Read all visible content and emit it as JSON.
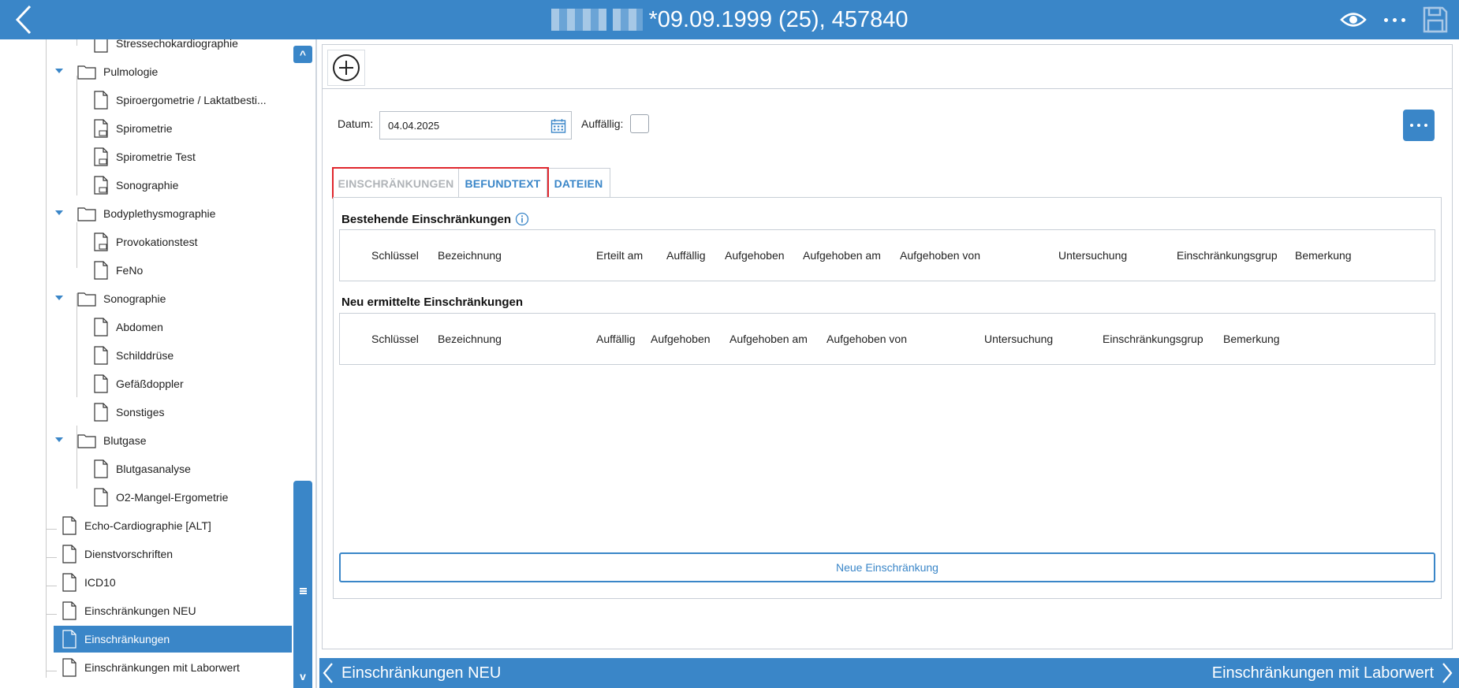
{
  "header": {
    "title": "*09.09.1999 (25), 457840",
    "back_icon": "chevron-left-icon",
    "view_icon": "eye-icon",
    "more_icon": "more-horizontal-icon",
    "save_icon": "floppy-disk-icon"
  },
  "tree": {
    "items": [
      {
        "label": "Stressechokardiographie",
        "kind": "doc"
      },
      {
        "label": "Pulmologie",
        "kind": "folder"
      },
      {
        "label": "Spiroergometrie / Laktatbesti...",
        "kind": "doc"
      },
      {
        "label": "Spirometrie",
        "kind": "form"
      },
      {
        "label": "Spirometrie Test",
        "kind": "form"
      },
      {
        "label": "Sonographie",
        "kind": "form"
      },
      {
        "label": "Bodyplethysmographie",
        "kind": "folder"
      },
      {
        "label": "Provokationstest",
        "kind": "form"
      },
      {
        "label": "FeNo",
        "kind": "doc"
      },
      {
        "label": "Sonographie",
        "kind": "folder"
      },
      {
        "label": "Abdomen",
        "kind": "doc"
      },
      {
        "label": "Schilddrüse",
        "kind": "doc"
      },
      {
        "label": "Gefäßdoppler",
        "kind": "doc"
      },
      {
        "label": "Sonstiges",
        "kind": "doc"
      },
      {
        "label": "Blutgase",
        "kind": "folder"
      },
      {
        "label": "Blutgasanalyse",
        "kind": "doc"
      },
      {
        "label": "O2-Mangel-Ergometrie",
        "kind": "doc"
      },
      {
        "label": "Echo-Cardiographie [ALT]",
        "kind": "doc"
      },
      {
        "label": "Dienstvorschriften",
        "kind": "doc"
      },
      {
        "label": "ICD10",
        "kind": "doc"
      },
      {
        "label": "Einschränkungen NEU",
        "kind": "doc"
      },
      {
        "label": "Einschränkungen",
        "kind": "doc",
        "selected": true
      },
      {
        "label": "Einschränkungen mit Laborwert",
        "kind": "doc"
      }
    ],
    "scroll_up": "^",
    "scroll_down": "v"
  },
  "form": {
    "datum_label": "Datum:",
    "datum_value": "04.04.2025",
    "auffaellig_label": "Auffällig:"
  },
  "tabs": [
    "EINSCHRÄNKUNGEN",
    "BEFUNDTEXT",
    "DATEIEN"
  ],
  "bestehende": {
    "title": "Bestehende Einschränkungen",
    "columns": [
      "Schlüssel",
      "Bezeichnung",
      "Erteilt am",
      "Auffällig",
      "Aufgehoben",
      "Aufgehoben am",
      "Aufgehoben von",
      "Untersuchung",
      "Einschränkungsgrup",
      "Bemerkung"
    ]
  },
  "neu": {
    "title": "Neu ermittelte Einschränkungen",
    "columns": [
      "Schlüssel",
      "Bezeichnung",
      "Auffällig",
      "Aufgehoben",
      "Aufgehoben am",
      "Aufgehoben von",
      "Untersuchung",
      "Einschränkungsgrup",
      "Bemerkung"
    ]
  },
  "new_button": "Neue Einschränkung",
  "bottom_nav": {
    "prev": "Einschränkungen NEU",
    "next": "Einschränkungen mit Laborwert"
  },
  "colors": {
    "accent": "#3a86c8",
    "highlight": "#e0262d"
  }
}
